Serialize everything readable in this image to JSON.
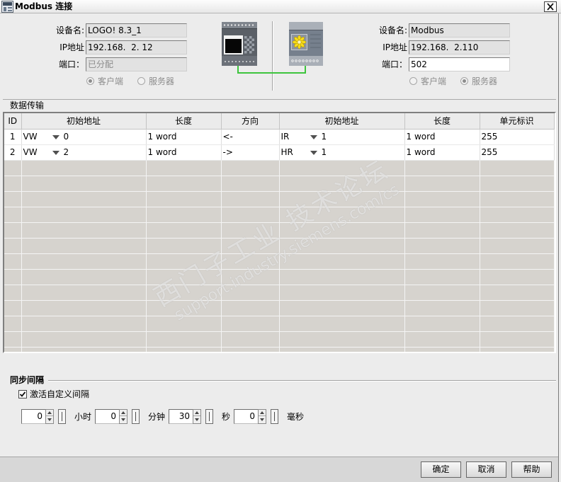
{
  "window": {
    "title": "Modbus 连接"
  },
  "icons": {
    "app_icon": "logo-app-icon",
    "close_icon": "close-icon",
    "dropdown_icon": "dropdown-arrow-icon"
  },
  "local_device": {
    "name_label": "设备名:",
    "name_value": "LOGO! 8.3_1",
    "ip_label": "IP地址",
    "ip_value": "192.168.  2. 12",
    "port_label": "端口：",
    "port_value": "已分配",
    "role_client_label": "客户端",
    "role_server_label": "服务器",
    "client_selected": true,
    "server_selected": false
  },
  "remote_device": {
    "name_label": "设备名:",
    "name_value": "Modbus",
    "ip_label": "IP地址",
    "ip_value": "192.168.  2.110",
    "port_label": "端口：",
    "port_value": "502",
    "role_client_label": "客户端",
    "role_server_label": "服务器",
    "client_selected": false,
    "server_selected": true
  },
  "connection_line_color": "#3dc43d",
  "data_transfer": {
    "section_label": "数据传输",
    "columns": [
      "ID",
      "初始地址",
      "长度",
      "方向",
      "初始地址",
      "长度",
      "单元标识"
    ],
    "rows": [
      {
        "id": "1",
        "local_area": "VW",
        "local_start": "0",
        "local_length": "1 word",
        "direction": "<-",
        "remote_area": "IR",
        "remote_start": "1",
        "remote_length": "1 word",
        "unit_id": "255"
      },
      {
        "id": "2",
        "local_area": "VW",
        "local_start": "2",
        "local_length": "1 word",
        "direction": "->",
        "remote_area": "HR",
        "remote_start": "1",
        "remote_length": "1 word",
        "unit_id": "255"
      }
    ]
  },
  "sync_interval": {
    "section_label": "同步间隔",
    "custom_interval_label": "激活自定义间隔",
    "custom_interval_checked": true,
    "fields": [
      {
        "value": "0",
        "unit": "小时"
      },
      {
        "value": "0",
        "unit": "分钟"
      },
      {
        "value": "30",
        "unit": "秒"
      },
      {
        "value": "0",
        "unit": "毫秒"
      }
    ]
  },
  "buttons": {
    "ok": "确定",
    "cancel": "取消",
    "help": "帮助"
  },
  "watermark": {
    "line1": "西门子工业 技术论坛",
    "line2": "support.industry.siemens.com/cs"
  }
}
